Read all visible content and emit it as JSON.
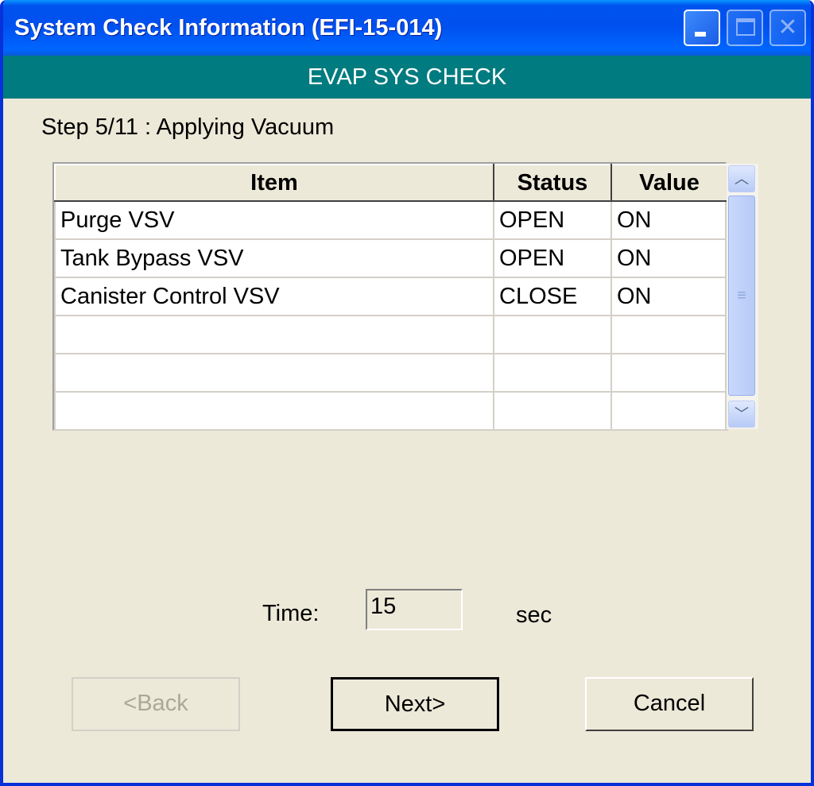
{
  "window": {
    "title": "System Check Information (EFI-15-014)",
    "minimize_label": "▁",
    "maximize_label": "☐",
    "close_label": "✕"
  },
  "banner": {
    "text": "EVAP SYS CHECK"
  },
  "step": {
    "text": "Step  5/11 : Applying Vacuum"
  },
  "table": {
    "headers": [
      "Item",
      "Status",
      "Value"
    ],
    "rows": [
      [
        "Purge VSV",
        "OPEN",
        "ON"
      ],
      [
        "Tank Bypass VSV",
        "OPEN",
        "ON"
      ],
      [
        "Canister Control VSV",
        "CLOSE",
        "ON"
      ],
      [
        "",
        "",
        ""
      ],
      [
        "",
        "",
        ""
      ],
      [
        "",
        "",
        ""
      ]
    ]
  },
  "time": {
    "label": "Time:",
    "value": "15",
    "unit": "sec"
  },
  "buttons": {
    "back": "<Back",
    "next": "Next>",
    "cancel": "Cancel"
  }
}
